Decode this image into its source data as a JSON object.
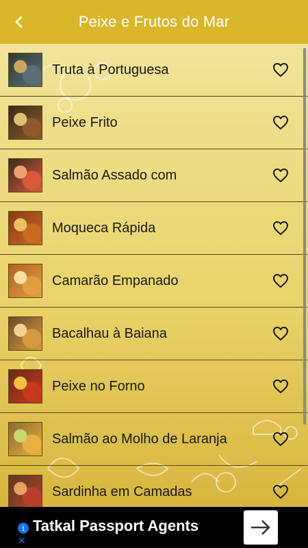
{
  "header": {
    "title": "Peixe e Frutos do Mar"
  },
  "recipes": [
    {
      "label": "Truta à Portuguesa",
      "colors": [
        "#5a6e7a",
        "#c8a860",
        "#2e3b2a"
      ]
    },
    {
      "label": "Peixe Frito",
      "colors": [
        "#8a5a2a",
        "#e0c070",
        "#3a2a18"
      ]
    },
    {
      "label": "Salmão Assado com",
      "colors": [
        "#d85a3a",
        "#f0a070",
        "#3a2a20"
      ]
    },
    {
      "label": "Moqueca Rápida",
      "colors": [
        "#c86a20",
        "#f0c060",
        "#8a3a18"
      ]
    },
    {
      "label": "Camarão Empanado",
      "colors": [
        "#e0a040",
        "#f7e0a0",
        "#b06020"
      ]
    },
    {
      "label": "Bacalhau à Baiana",
      "colors": [
        "#d89a40",
        "#f2d090",
        "#6a4a2a"
      ]
    },
    {
      "label": "Peixe no Forno",
      "colors": [
        "#c83a20",
        "#f0c040",
        "#6a2a18"
      ]
    },
    {
      "label": "Salmão ao Molho de Laranja",
      "colors": [
        "#e8b040",
        "#c8d870",
        "#8a6a30"
      ]
    },
    {
      "label": "Sardinha em Camadas",
      "colors": [
        "#b8402a",
        "#e8a060",
        "#5a3a20"
      ]
    }
  ],
  "ad": {
    "text": "Tatkal Passport Agents",
    "info": "i",
    "close": "✕"
  },
  "icons": {
    "back": "chevron-left",
    "favorite": "heart-outline",
    "ad_cta": "arrow-right"
  },
  "colors": {
    "appbar": "#d9b62a",
    "row_divider": "#5a4a14"
  }
}
